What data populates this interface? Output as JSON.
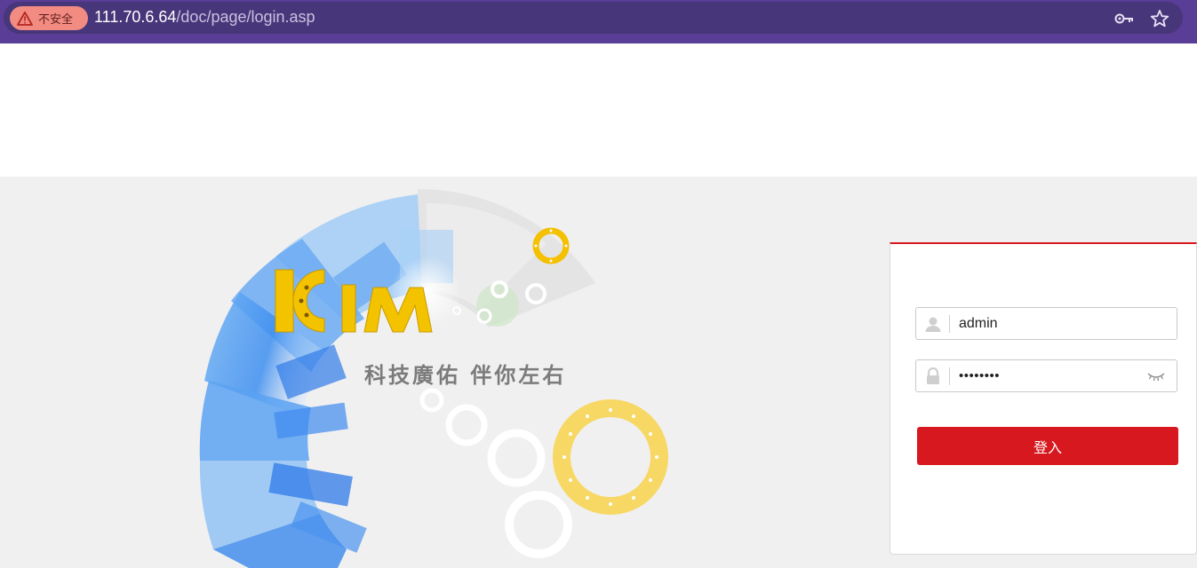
{
  "browser": {
    "security_label": "不安全",
    "url_host": "111.70.6.64",
    "url_path": "/doc/page/login.asp",
    "icons": [
      "warning-icon",
      "key-icon",
      "star-icon"
    ]
  },
  "brand": {
    "logo_text": "KIM",
    "slogan": "科技廣佑 伴你左右"
  },
  "login": {
    "username_value": "admin",
    "password_value": "••••••••",
    "submit_label": "登入",
    "accent_color": "#d7181f"
  }
}
